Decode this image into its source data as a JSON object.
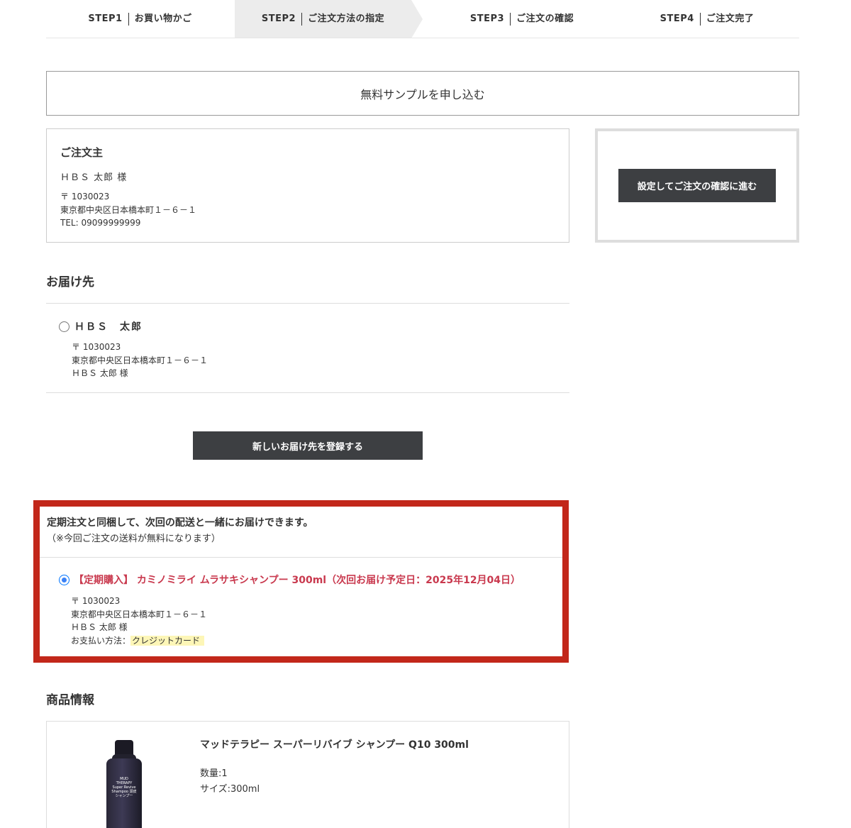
{
  "steps": [
    {
      "num": "STEP1",
      "label": "お買い物かご"
    },
    {
      "num": "STEP2",
      "label": "ご注文方法の指定"
    },
    {
      "num": "STEP3",
      "label": "ご注文の確認"
    },
    {
      "num": "STEP4",
      "label": "ご注文完了"
    }
  ],
  "sample_button": "無料サンプルを申し込む",
  "orderer": {
    "title": "ご注文主",
    "name": "ＨＢＳ 太郎 様",
    "postal": "〒 1030023",
    "address": "東京都中央区日本橋本町１－６－１",
    "tel": "TEL: 09099999999"
  },
  "side": {
    "proceed_button": "設定してご注文の確認に進む"
  },
  "delivery": {
    "title": "お届け先",
    "options": [
      {
        "name": "ＨＢＳ　太郎",
        "postal": "〒 1030023",
        "address": "東京都中央区日本橋本町１－６－１",
        "recipient": "ＨＢＳ 太郎 様",
        "selected": false
      }
    ],
    "new_address_button": "新しいお届け先を登録する"
  },
  "subscription": {
    "heading": "定期注文と同梱して、次回の配送と一緒にお届けできます。",
    "note": "（※今回ご注文の送料が無料になります）",
    "item": "【定期購入】 カミノミライ ムラサキシャンプー 300ml（次回お届け予定日：2025年12月04日）",
    "postal": "〒 1030023",
    "address": "東京都中央区日本橋本町１－６－１",
    "recipient": "ＨＢＳ 太郎 様",
    "payment_label": "お支払い方法：",
    "payment_value": "クレジットカード",
    "selected": true
  },
  "product": {
    "title": "商品情報",
    "name": "マッドテラピー スーパーリバイブ シャンプー Q10 300ml",
    "quantity": "数量:1",
    "size": "サイズ:300ml",
    "bottle_label": "MUD THERAPY Super Revive Shampoo 頭皮シャンプー"
  },
  "colors": {
    "accent_red": "#c2271a",
    "item_text": "#c9394e",
    "dark_button": "#3d3f42",
    "highlight": "#fdf6b7"
  }
}
